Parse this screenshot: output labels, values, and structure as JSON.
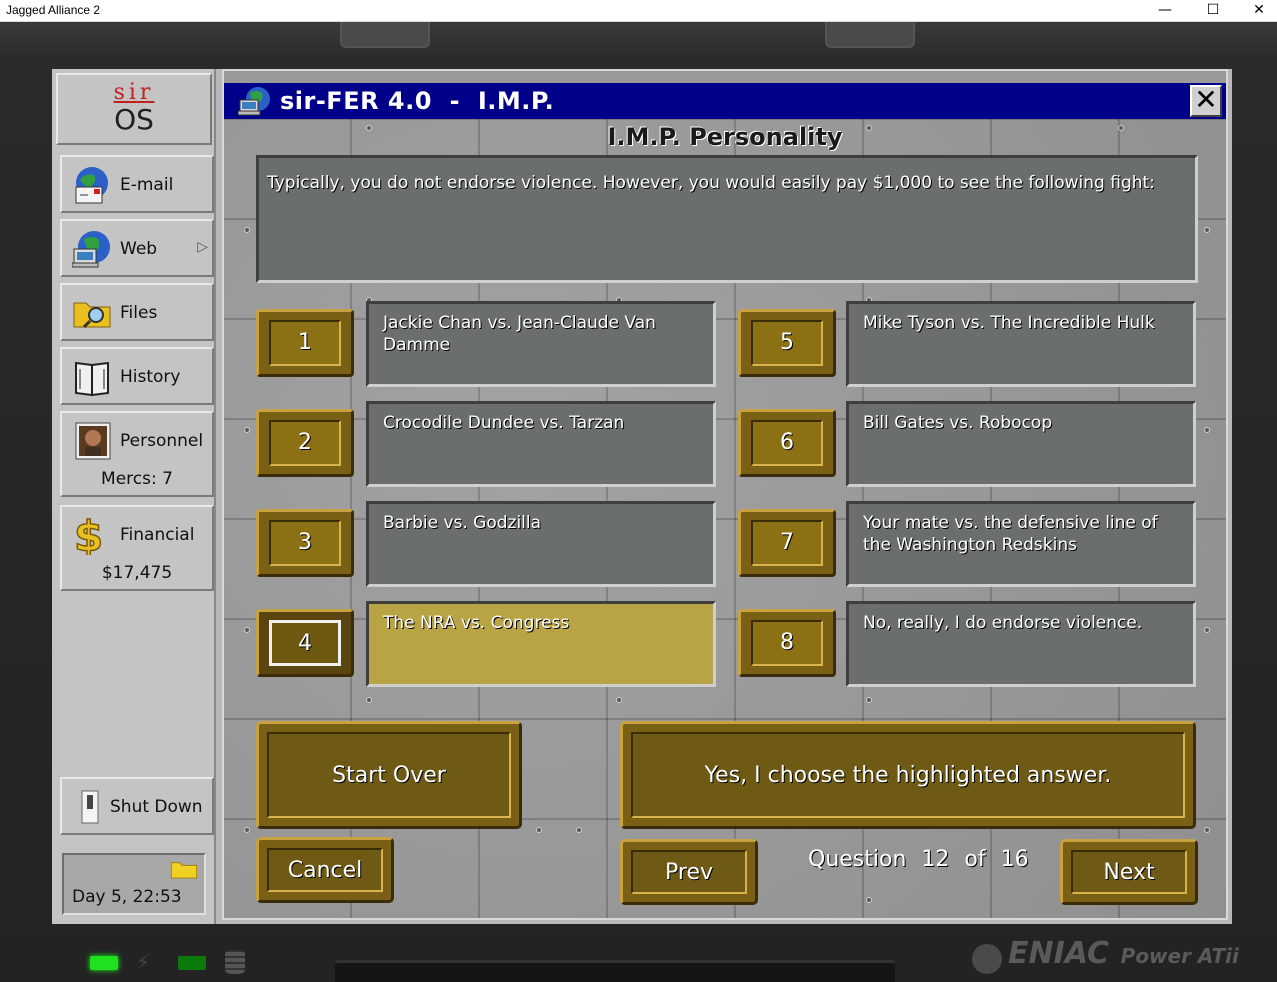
{
  "window": {
    "title": "Jagged Alliance 2",
    "minimize": "—",
    "maximize": "☐",
    "close": "✕"
  },
  "sidebar": {
    "logo_top": "sir",
    "logo_bottom": "OS",
    "items": [
      {
        "label": "E-mail",
        "icon": "email-icon"
      },
      {
        "label": "Web",
        "icon": "web-icon"
      },
      {
        "label": "Files",
        "icon": "files-icon"
      },
      {
        "label": "History",
        "icon": "history-icon"
      },
      {
        "label": "Personnel",
        "icon": "personnel-icon",
        "sub": "Mercs: 7"
      },
      {
        "label": "Financial",
        "icon": "financial-icon",
        "sub": "$17,475"
      }
    ],
    "shutdown_label": "Shut Down",
    "day_time": "Day 5, 22:53"
  },
  "imp": {
    "title": "sir-FER 4.0  -  I.M.P.",
    "section_title": "I.M.P. Personality",
    "question": "Typically, you do not endorse violence. However, you would easily pay $1,000 to see the following fight:",
    "answers": [
      {
        "num": "1",
        "text": "Jackie Chan vs. Jean-Claude Van Damme"
      },
      {
        "num": "2",
        "text": "Crocodile Dundee vs. Tarzan"
      },
      {
        "num": "3",
        "text": "Barbie vs. Godzilla"
      },
      {
        "num": "4",
        "text": "The NRA vs. Congress"
      },
      {
        "num": "5",
        "text": "Mike Tyson vs. The Incredible Hulk"
      },
      {
        "num": "6",
        "text": "Bill Gates vs. Robocop"
      },
      {
        "num": "7",
        "text": "Your mate vs. the defensive line of the Washington Redskins"
      },
      {
        "num": "8",
        "text": "No, really, I do endorse violence."
      }
    ],
    "selected_answer": 4,
    "start_over": "Start Over",
    "confirm": "Yes, I choose the highlighted answer.",
    "cancel": "Cancel",
    "prev": "Prev",
    "next": "Next",
    "counter_label": "Question",
    "counter_current": "12",
    "counter_of": "of",
    "counter_total": "16"
  },
  "bezel": {
    "brand": "ENIAC",
    "model": "Power ATii"
  },
  "colors": {
    "title_bar": "#000088",
    "selected_answer": "#b9a445",
    "answer_box": "#6b6f6b",
    "gold_button": "#7a6014"
  }
}
